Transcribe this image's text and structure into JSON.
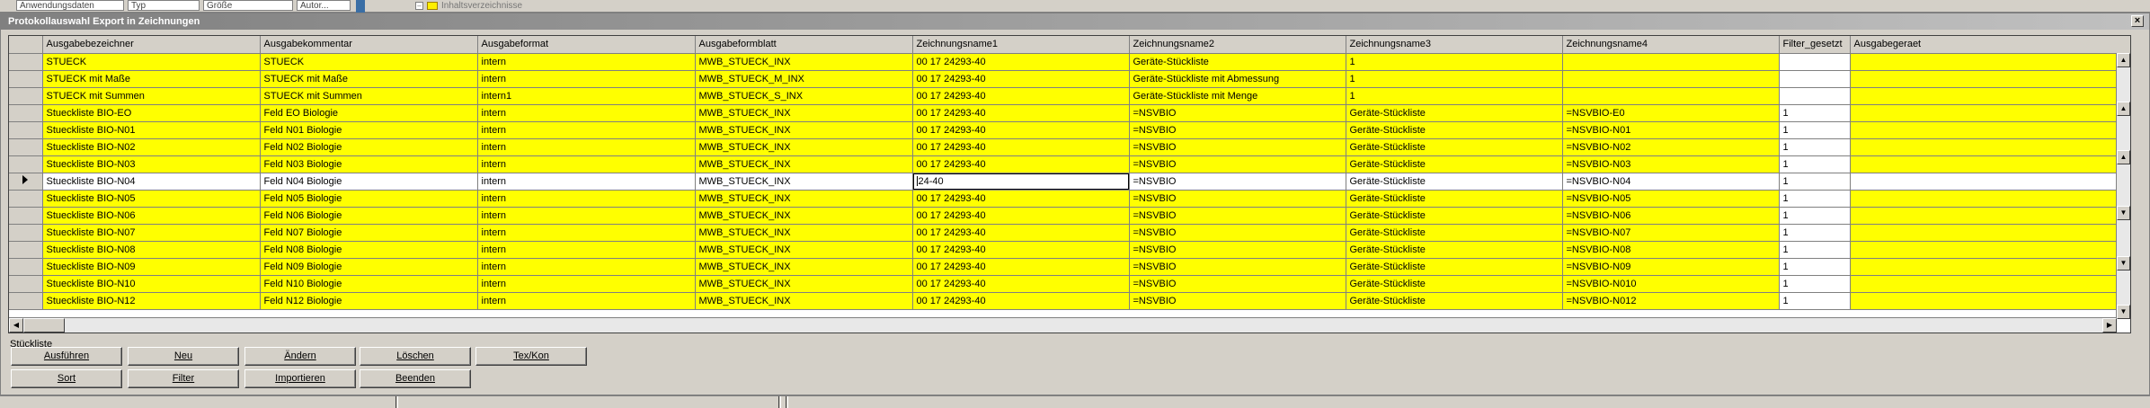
{
  "top_strip": {
    "cells": [
      "Anwendungsdaten",
      "Typ",
      "Größe",
      "Autor..."
    ],
    "tree_toggle": "–",
    "tree_item": "Inhaltsverzeichnisse"
  },
  "window": {
    "title": "Protokollauswahl Export in Zeichnungen",
    "close_label": "×"
  },
  "grid": {
    "columns": [
      "Ausgabebezeichner",
      "Ausgabekommentar",
      "Ausgabeformat",
      "Ausgabeformblatt",
      "Zeichnungsname1",
      "Zeichnungsname2",
      "Zeichnungsname3",
      "Zeichnungsname4",
      "Filter_gesetzt",
      "Ausgabegeraet"
    ],
    "rows": [
      [
        "STUECK",
        "STUECK",
        "intern",
        "MWB_STUECK_INX",
        "00 17 24293-40",
        "Geräte-Stückliste",
        "1",
        "",
        "",
        ""
      ],
      [
        "STUECK mit Maße",
        "STUECK mit Maße",
        "intern",
        "MWB_STUECK_M_INX",
        "00 17 24293-40",
        "Geräte-Stückliste mit Abmessung",
        "1",
        "",
        "",
        ""
      ],
      [
        "STUECK mit Summen",
        "STUECK mit Summen",
        "intern1",
        "MWB_STUECK_S_INX",
        "00 17 24293-40",
        "Geräte-Stückliste mit Menge",
        "1",
        "",
        "",
        ""
      ],
      [
        "Stueckliste BIO-EO",
        "Feld EO Biologie",
        "intern",
        "MWB_STUECK_INX",
        "00 17 24293-40",
        "=NSVBIO",
        "Geräte-Stückliste",
        "=NSVBIO-E0",
        "1",
        ""
      ],
      [
        "Stueckliste BIO-N01",
        "Feld N01 Biologie",
        "intern",
        "MWB_STUECK_INX",
        "00 17 24293-40",
        "=NSVBIO",
        "Geräte-Stückliste",
        "=NSVBIO-N01",
        "1",
        ""
      ],
      [
        "Stueckliste BIO-N02",
        "Feld N02 Biologie",
        "intern",
        "MWB_STUECK_INX",
        "00 17 24293-40",
        "=NSVBIO",
        "Geräte-Stückliste",
        "=NSVBIO-N02",
        "1",
        ""
      ],
      [
        "Stueckliste BIO-N03",
        "Feld N03 Biologie",
        "intern",
        "MWB_STUECK_INX",
        "00 17 24293-40",
        "=NSVBIO",
        "Geräte-Stückliste",
        "=NSVBIO-N03",
        "1",
        ""
      ],
      [
        "Stueckliste BIO-N04",
        "Feld N04 Biologie",
        "intern",
        "MWB_STUECK_INX",
        "24-40",
        "=NSVBIO",
        "Geräte-Stückliste",
        "=NSVBIO-N04",
        "1",
        ""
      ],
      [
        "Stueckliste BIO-N05",
        "Feld N05 Biologie",
        "intern",
        "MWB_STUECK_INX",
        "00 17 24293-40",
        "=NSVBIO",
        "Geräte-Stückliste",
        "=NSVBIO-N05",
        "1",
        ""
      ],
      [
        "Stueckliste BIO-N06",
        "Feld N06 Biologie",
        "intern",
        "MWB_STUECK_INX",
        "00 17 24293-40",
        "=NSVBIO",
        "Geräte-Stückliste",
        "=NSVBIO-N06",
        "1",
        ""
      ],
      [
        "Stueckliste BIO-N07",
        "Feld N07 Biologie",
        "intern",
        "MWB_STUECK_INX",
        "00 17 24293-40",
        "=NSVBIO",
        "Geräte-Stückliste",
        "=NSVBIO-N07",
        "1",
        ""
      ],
      [
        "Stueckliste BIO-N08",
        "Feld N08 Biologie",
        "intern",
        "MWB_STUECK_INX",
        "00 17 24293-40",
        "=NSVBIO",
        "Geräte-Stückliste",
        "=NSVBIO-N08",
        "1",
        ""
      ],
      [
        "Stueckliste BIO-N09",
        "Feld N09 Biologie",
        "intern",
        "MWB_STUECK_INX",
        "00 17 24293-40",
        "=NSVBIO",
        "Geräte-Stückliste",
        "=NSVBIO-N09",
        "1",
        ""
      ],
      [
        "Stueckliste BIO-N10",
        "Feld N10 Biologie",
        "intern",
        "MWB_STUECK_INX",
        "00 17 24293-40",
        "=NSVBIO",
        "Geräte-Stückliste",
        "=NSVBIO-N010",
        "1",
        ""
      ],
      [
        "Stueckliste BIO-N12",
        "Feld N12 Biologie",
        "intern",
        "MWB_STUECK_INX",
        "00 17 24293-40",
        "=NSVBIO",
        "Geräte-Stückliste",
        "=NSVBIO-N012",
        "1",
        ""
      ]
    ],
    "selected_row": 7,
    "editing_col": 4
  },
  "section_label": "Stückliste",
  "buttons": {
    "row1": [
      "Ausführen",
      "Neu",
      "Ändern",
      "Löschen",
      "Tex/Kon"
    ],
    "row2": [
      "Sort",
      "Filter",
      "Importieren",
      "Beenden"
    ]
  },
  "colors": {
    "row_highlight": "#ffff00",
    "titlebar": "#808080",
    "face": "#d4d0c8"
  }
}
